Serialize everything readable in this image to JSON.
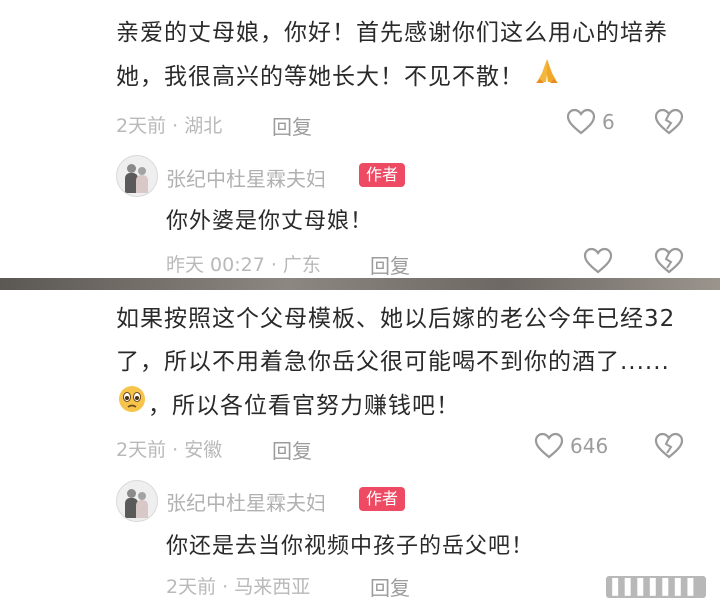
{
  "comment1": {
    "text": "亲爱的丈母娘，你好！首先感谢你们这么用心的培养她，我很高兴的等她长大！不见不散！",
    "emoji": "pray-emoji",
    "meta": "2天前 · 湖北",
    "reply_label": "回复",
    "likes": "6",
    "reply": {
      "author": "张纪中杜星霖夫妇",
      "badge": "作者",
      "text": "你外婆是你丈母娘！",
      "meta": "昨天 00:27 · 广东",
      "reply_label": "回复"
    }
  },
  "comment2": {
    "text_before_emoji": "如果按照这个父母模板、她以后嫁的老公今年已经32了，所以不用着急你岳父很可能喝不到你的酒了......",
    "emoji": "teary-face-emoji",
    "text_after_emoji": "，所以各位看官努力赚钱吧！",
    "meta": "2天前 · 安徽",
    "reply_label": "回复",
    "likes": "646",
    "reply": {
      "author": "张纪中杜星霖夫妇",
      "badge": "作者",
      "text": "你还是去当你视频中孩子的岳父吧！",
      "meta": "2天前 · 马来西亚",
      "reply_label": "回复"
    }
  },
  "watermark": "▌▌▌▌▌▌▌",
  "colors": {
    "badge": "#ef4a64",
    "text": "#2a2a2a",
    "meta": "#b9b9b9"
  }
}
